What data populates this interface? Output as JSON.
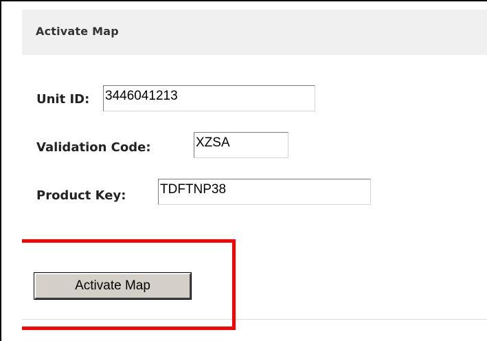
{
  "header": {
    "title": "Activate Map"
  },
  "form": {
    "unit_id": {
      "label": "Unit ID:",
      "value": "3446041213"
    },
    "validation_code": {
      "label": "Validation Code:",
      "value": "XZSA"
    },
    "product_key": {
      "label": "Product Key:",
      "value": "TDFTNP38"
    }
  },
  "actions": {
    "activate_label": "Activate Map"
  },
  "colors": {
    "highlight": "#ff0000",
    "header_background": "#f0f0f0",
    "button_face": "#d4d0c8"
  }
}
